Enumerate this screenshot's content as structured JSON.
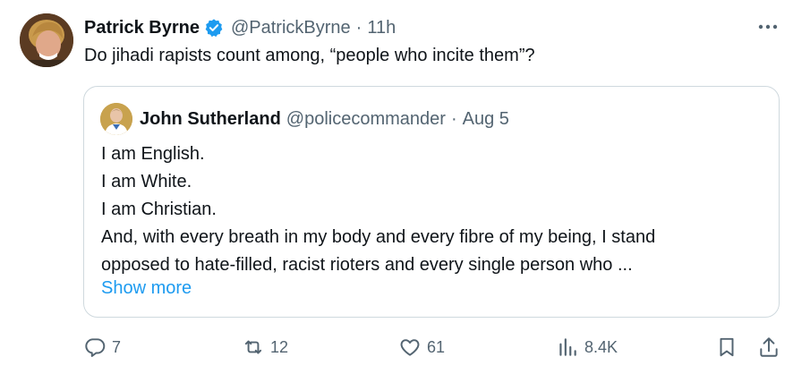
{
  "tweet": {
    "author_name": "Patrick Byrne",
    "author_handle": "@PatrickByrne",
    "separator": "·",
    "time": "11h",
    "text": "Do jihadi rapists count among, “people who incite them”?",
    "avatar_icon": "profile-photo",
    "verified_icon": "verified-badge-icon",
    "more_icon": "more-dots-icon"
  },
  "quote": {
    "author_name": "John Sutherland",
    "author_handle": "@policecommander",
    "separator": "·",
    "date": "Aug 5",
    "lines": [
      "I am English.",
      "I am White.",
      "I am Christian.",
      "And, with every breath in my body and every fibre of my being, I stand",
      "opposed to hate-filled, racist rioters and every single person who ..."
    ],
    "show_more": "Show more"
  },
  "actions": {
    "replies": "7",
    "reposts": "12",
    "likes": "61",
    "views": "8.4K"
  },
  "colors": {
    "text": "#0f1419",
    "secondary": "#536471",
    "accent": "#1d9bf0",
    "border": "#cfd9de"
  }
}
